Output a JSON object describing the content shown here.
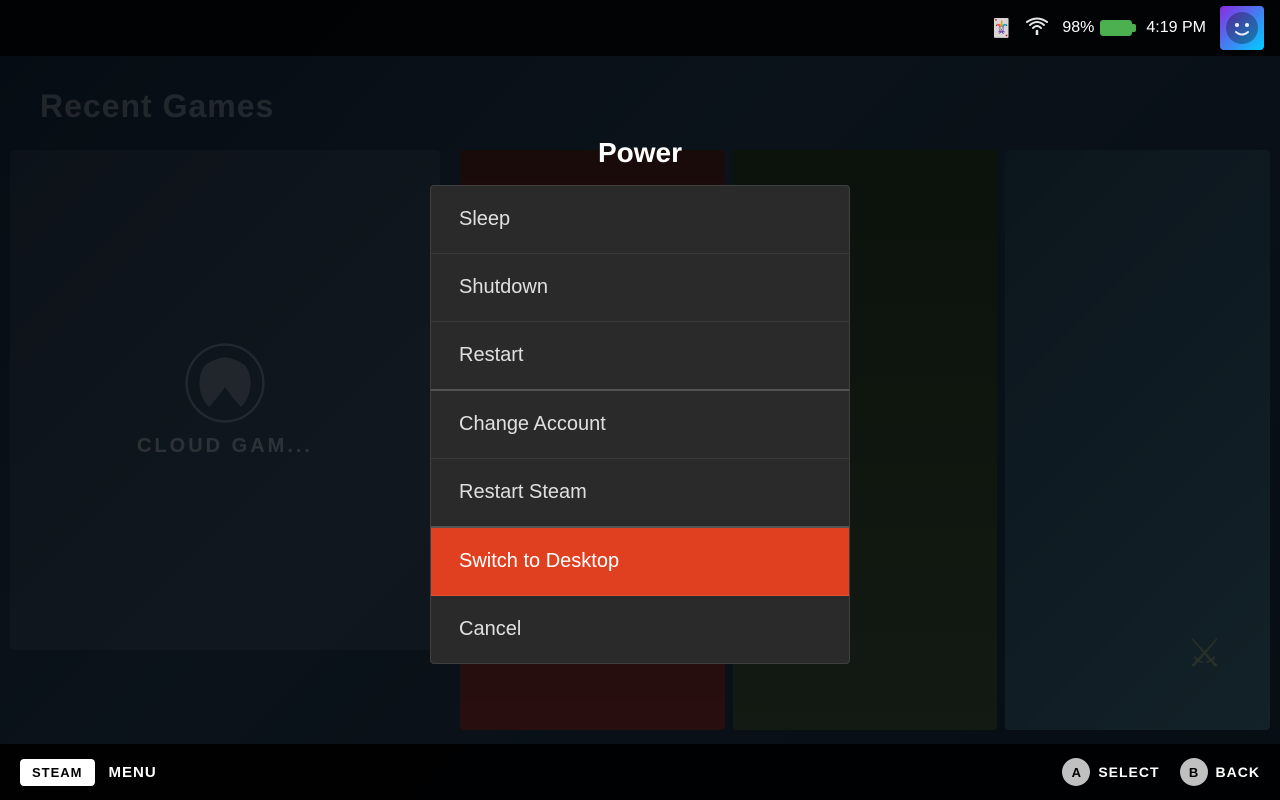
{
  "background": {
    "title": "Recent Games",
    "card_label": "CLOUD GAM..."
  },
  "status_bar": {
    "battery_percent": "98%",
    "time": "4:19 PM",
    "sd_icon": "💾",
    "wifi_icon": "📶"
  },
  "dialog": {
    "title": "Power",
    "items": [
      {
        "id": "sleep",
        "label": "Sleep",
        "selected": false,
        "separator_after": false
      },
      {
        "id": "shutdown",
        "label": "Shutdown",
        "selected": false,
        "separator_after": false
      },
      {
        "id": "restart",
        "label": "Restart",
        "selected": false,
        "separator_after": true
      },
      {
        "id": "change-account",
        "label": "Change Account",
        "selected": false,
        "separator_after": false
      },
      {
        "id": "restart-steam",
        "label": "Restart Steam",
        "selected": false,
        "separator_after": true
      },
      {
        "id": "switch-to-desktop",
        "label": "Switch to Desktop",
        "selected": true,
        "separator_after": false
      },
      {
        "id": "cancel",
        "label": "Cancel",
        "selected": false,
        "separator_after": false
      }
    ]
  },
  "bottom_bar": {
    "steam_label": "STEAM",
    "menu_label": "MENU",
    "select_label": "SELECT",
    "back_label": "BACK",
    "btn_a": "A",
    "btn_b": "B"
  }
}
